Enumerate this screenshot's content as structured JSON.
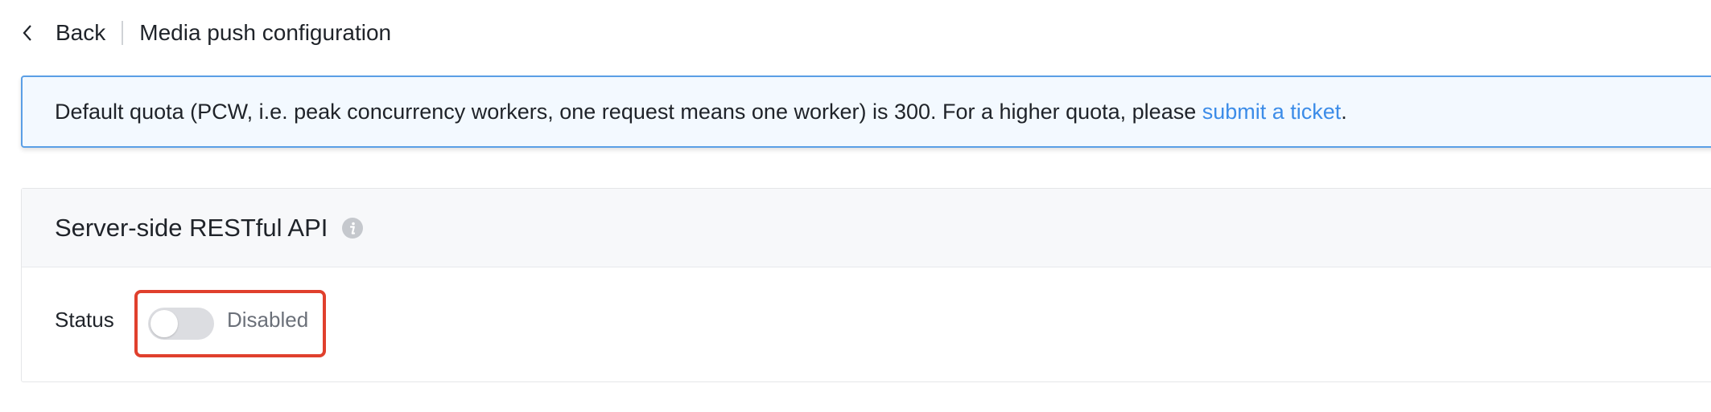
{
  "header": {
    "back_label": "Back",
    "page_title": "Media push configuration"
  },
  "notice": {
    "text": "Default quota (PCW, i.e. peak concurrency workers, one request means one worker) is 300. For a higher quota, please ",
    "link_text": "submit a ticket",
    "suffix": "."
  },
  "panel": {
    "title": "Server-side RESTful API",
    "status_label": "Status",
    "toggle_state_text": "Disabled",
    "toggle_enabled": false
  },
  "icons": {
    "back": "chevron-left-icon",
    "info": "info-icon"
  },
  "colors": {
    "link": "#3c8ce8",
    "notice_border": "#5a9fe6",
    "notice_bg": "#f3f9ff",
    "highlight": "#e0402d",
    "toggle_off": "#dcdde1"
  }
}
